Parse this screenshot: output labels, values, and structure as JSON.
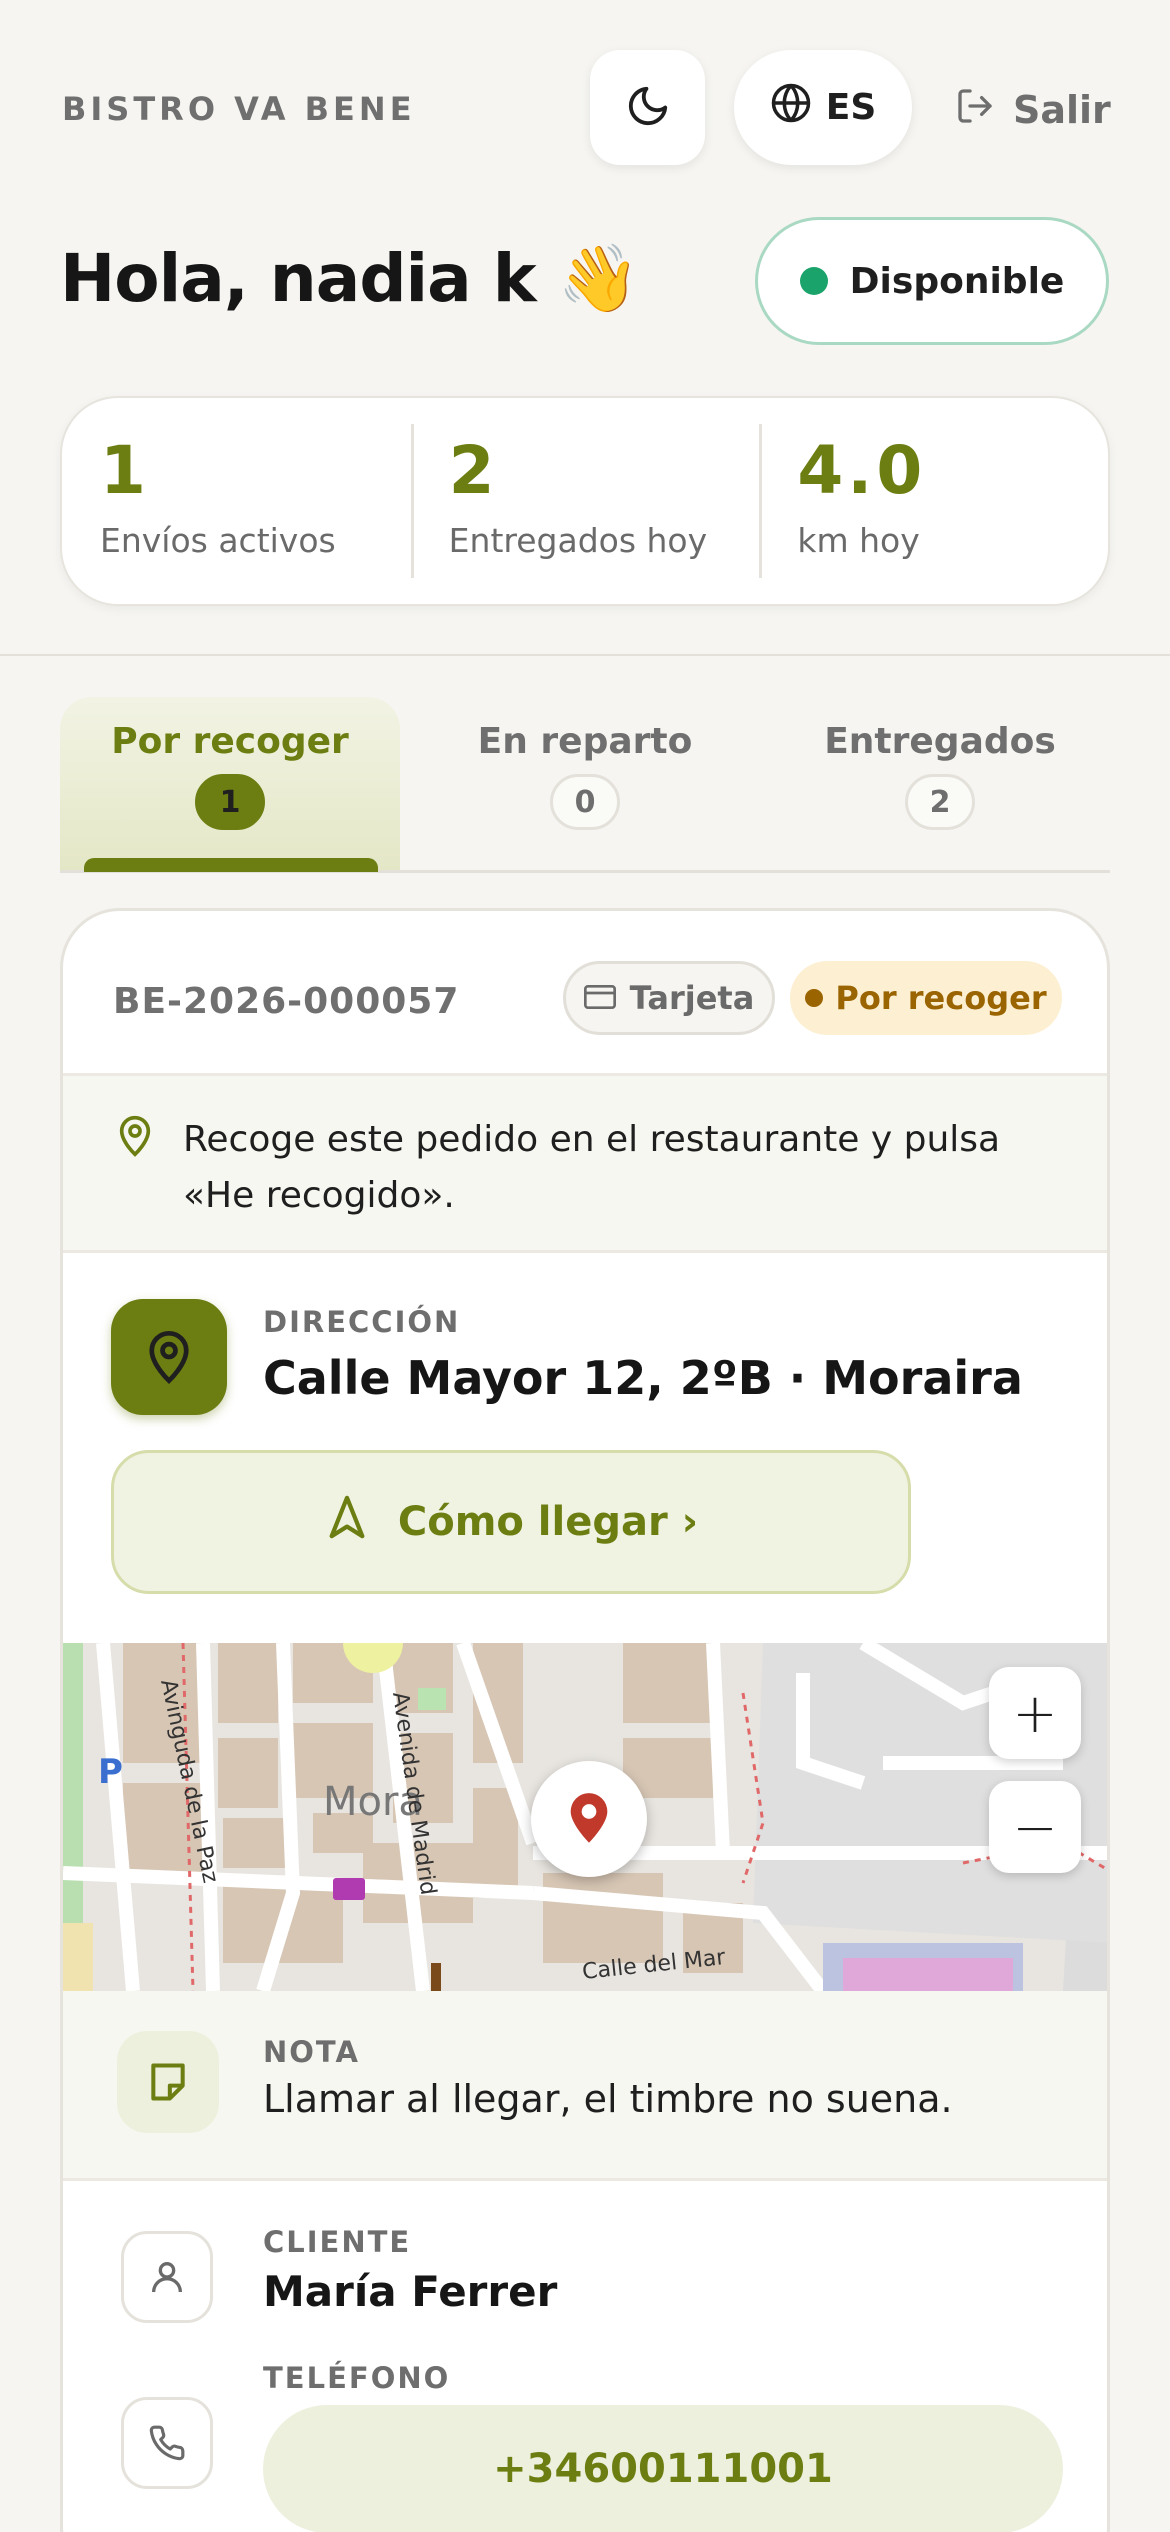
{
  "header": {
    "brand": "BISTRO VA BENE",
    "language": "ES",
    "logout_label": "Salir",
    "theme_icon": "moon-icon",
    "language_icon": "globe-icon",
    "logout_icon": "logout-icon"
  },
  "greeting": {
    "text": "Hola, nadia k 👋",
    "status": "Disponible",
    "status_color": "#1aa36a"
  },
  "stats": [
    {
      "value": "1",
      "label": "Envíos activos"
    },
    {
      "value": "2",
      "label": "Entregados hoy"
    },
    {
      "value": "4.0",
      "label": "km hoy"
    }
  ],
  "tabs": [
    {
      "label": "Por recoger",
      "count": "1",
      "active": true
    },
    {
      "label": "En reparto",
      "count": "0",
      "active": false
    },
    {
      "label": "Entregados",
      "count": "2",
      "active": false
    }
  ],
  "order": {
    "id": "BE-2026-000057",
    "payment": "Tarjeta",
    "status": "Por recoger",
    "instruction": "Recoge este pedido en el restaurante y pulsa «He recogido».",
    "address_label": "DIRECCIÓN",
    "address": "Calle Mayor 12, 2ºB · Moraira",
    "directions_label": "Cómo llegar ›",
    "map": {
      "zoom_in": "+",
      "zoom_out": "−",
      "street_labels": [
        "Avinguda de la Paz",
        "Avenida de Madrid",
        "Moraira",
        "Calle del Mar"
      ]
    },
    "note_label": "NOTA",
    "note": "Llamar al llegar, el timbre no suena.",
    "client_label": "CLIENTE",
    "client_name": "María Ferrer",
    "phone_label": "TELÉFONO",
    "phone": "+34600111001"
  },
  "colors": {
    "accent": "#6c7e12",
    "background": "#f6f5f1",
    "pending_badge": "#fdf0d2",
    "pin": "#c0392b"
  }
}
